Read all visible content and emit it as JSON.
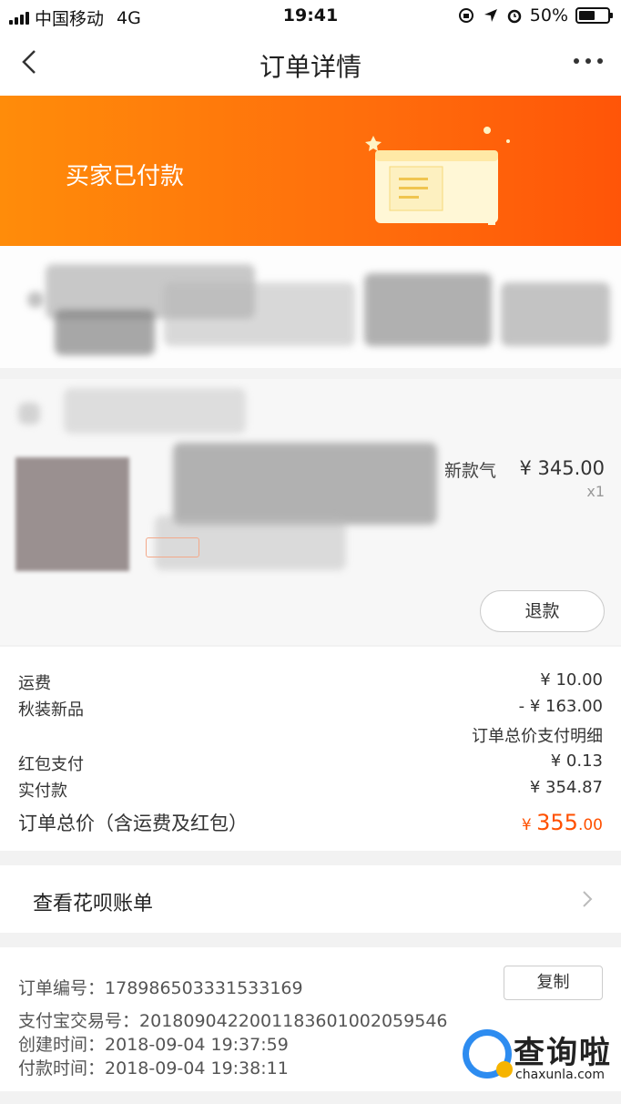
{
  "status_bar": {
    "carrier": "中国移动",
    "network": "4G",
    "time": "19:41",
    "battery": "50%"
  },
  "nav": {
    "title": "订单详情"
  },
  "banner": {
    "status": "买家已付款",
    "color_start": "#ff8c0a",
    "color_end": "#ff5508"
  },
  "product": {
    "title_fragment": "新款气",
    "price": "¥ 345.00",
    "quantity": "x1",
    "refund_label": "退款"
  },
  "fees": [
    {
      "label": "运费",
      "amount": "¥ 10.00"
    },
    {
      "label": "秋装新品",
      "amount": "- ¥ 163.00"
    }
  ],
  "detail_link": "订单总价支付明细",
  "payments": [
    {
      "label": "红包支付",
      "amount": "¥ 0.13"
    },
    {
      "label": "实付款",
      "amount": "¥ 354.87"
    }
  ],
  "total": {
    "label": "订单总价（含运费及红包）",
    "currency": "¥",
    "integer": "355",
    "decimal": ".00",
    "color": "#ff5000"
  },
  "huabei": {
    "label": "查看花呗账单"
  },
  "order_info": {
    "order_no_label": "订单编号：",
    "order_no": "178986503331533169",
    "copy_label": "复制",
    "alipay_label": "支付宝交易号：",
    "alipay_no": "2018090422001183601002059546",
    "created_label": "创建时间：",
    "created": "2018-09-04 19:37:59",
    "paid_label": "付款时间：",
    "paid": "2018-09-04 19:38:11"
  },
  "watermark": {
    "title": "查询啦",
    "subtitle": "chaxunla.com"
  }
}
